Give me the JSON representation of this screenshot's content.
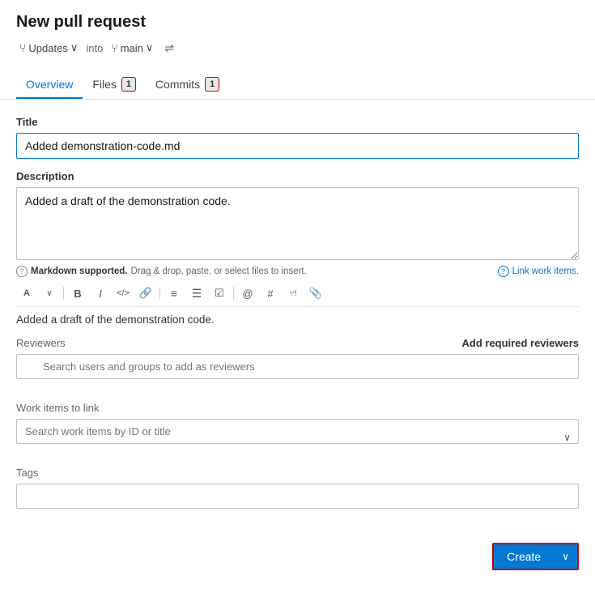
{
  "page": {
    "title": "New pull request"
  },
  "branch_row": {
    "from_icon": "⑂",
    "from_label": "Updates",
    "from_chevron": "∨",
    "into_text": "into",
    "to_icon": "⑂",
    "to_label": "main",
    "to_chevron": "∨",
    "swap_icon": "⇌"
  },
  "tabs": [
    {
      "id": "overview",
      "label": "Overview",
      "badge": null,
      "active": true
    },
    {
      "id": "files",
      "label": "Files",
      "badge": "1",
      "active": false
    },
    {
      "id": "commits",
      "label": "Commits",
      "badge": "1",
      "active": false
    }
  ],
  "form": {
    "title_label": "Title",
    "title_value": "Added demonstration-code.md",
    "title_placeholder": "Title",
    "description_label": "Description",
    "description_value": "Added a draft of the demonstration code.",
    "description_placeholder": "",
    "markdown_hint": "Markdown supported.",
    "markdown_drag": " Drag & drop, paste, or select files to insert.",
    "link_work_items": "Link work items.",
    "preview_text": "Added a draft of the demonstration code.",
    "reviewers_label": "Reviewers",
    "add_reviewers_label": "Add required reviewers",
    "reviewer_search_placeholder": "Search users and groups to add as reviewers",
    "work_items_label": "Work items to link",
    "work_items_placeholder": "Search work items by ID or title",
    "tags_label": "Tags",
    "tags_value": "",
    "create_label": "Create"
  },
  "toolbar": {
    "buttons": [
      {
        "name": "style-dropdown",
        "icon": "A",
        "title": "Styles"
      },
      {
        "name": "style-chevron",
        "icon": "∨",
        "title": "Style dropdown"
      },
      {
        "name": "bold",
        "icon": "B",
        "title": "Bold"
      },
      {
        "name": "italic",
        "icon": "I",
        "title": "Italic"
      },
      {
        "name": "code",
        "icon": "</>",
        "title": "Code"
      },
      {
        "name": "link",
        "icon": "🔗",
        "title": "Link"
      },
      {
        "name": "ordered-list",
        "icon": "≡",
        "title": "Ordered list"
      },
      {
        "name": "unordered-list",
        "icon": "☰",
        "title": "Unordered list"
      },
      {
        "name": "task-list",
        "icon": "☑",
        "title": "Task list"
      },
      {
        "name": "mention",
        "icon": "@",
        "title": "Mention"
      },
      {
        "name": "heading",
        "icon": "#",
        "title": "Heading"
      },
      {
        "name": "pr-link",
        "icon": "PR",
        "title": "PR link"
      },
      {
        "name": "attach",
        "icon": "📎",
        "title": "Attach file"
      }
    ]
  }
}
